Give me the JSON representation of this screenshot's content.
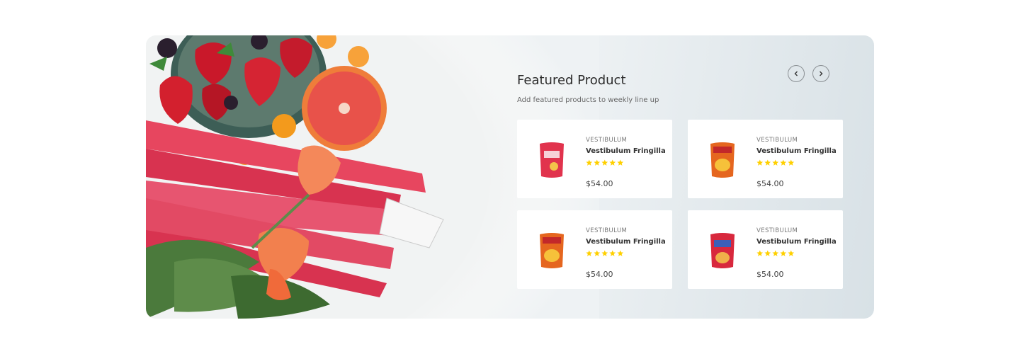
{
  "section": {
    "title": "Featured Product",
    "subtitle": "Add featured products to weekly line up",
    "nav": {
      "prev_icon": "chevron-left-icon",
      "next_icon": "chevron-right-icon"
    }
  },
  "colors": {
    "star": "#ffd000",
    "title": "#2b2b2b"
  },
  "products": [
    {
      "category": "VESTIBULUM",
      "name": "Vestibulum Fringilla ...",
      "price": "$54.00",
      "rating": 5,
      "image": "chips-bag-red"
    },
    {
      "category": "VESTIBULUM",
      "name": "Vestibulum Fringilla ...",
      "price": "$54.00",
      "rating": 5,
      "image": "chips-bag-orange"
    },
    {
      "category": "VESTIBULUM",
      "name": "Vestibulum Fringilla ...",
      "price": "$54.00",
      "rating": 5,
      "image": "chips-bag-orange"
    },
    {
      "category": "VESTIBULUM",
      "name": "Vestibulum Fringilla ...",
      "price": "$54.00",
      "rating": 5,
      "image": "chips-bag-red"
    }
  ]
}
